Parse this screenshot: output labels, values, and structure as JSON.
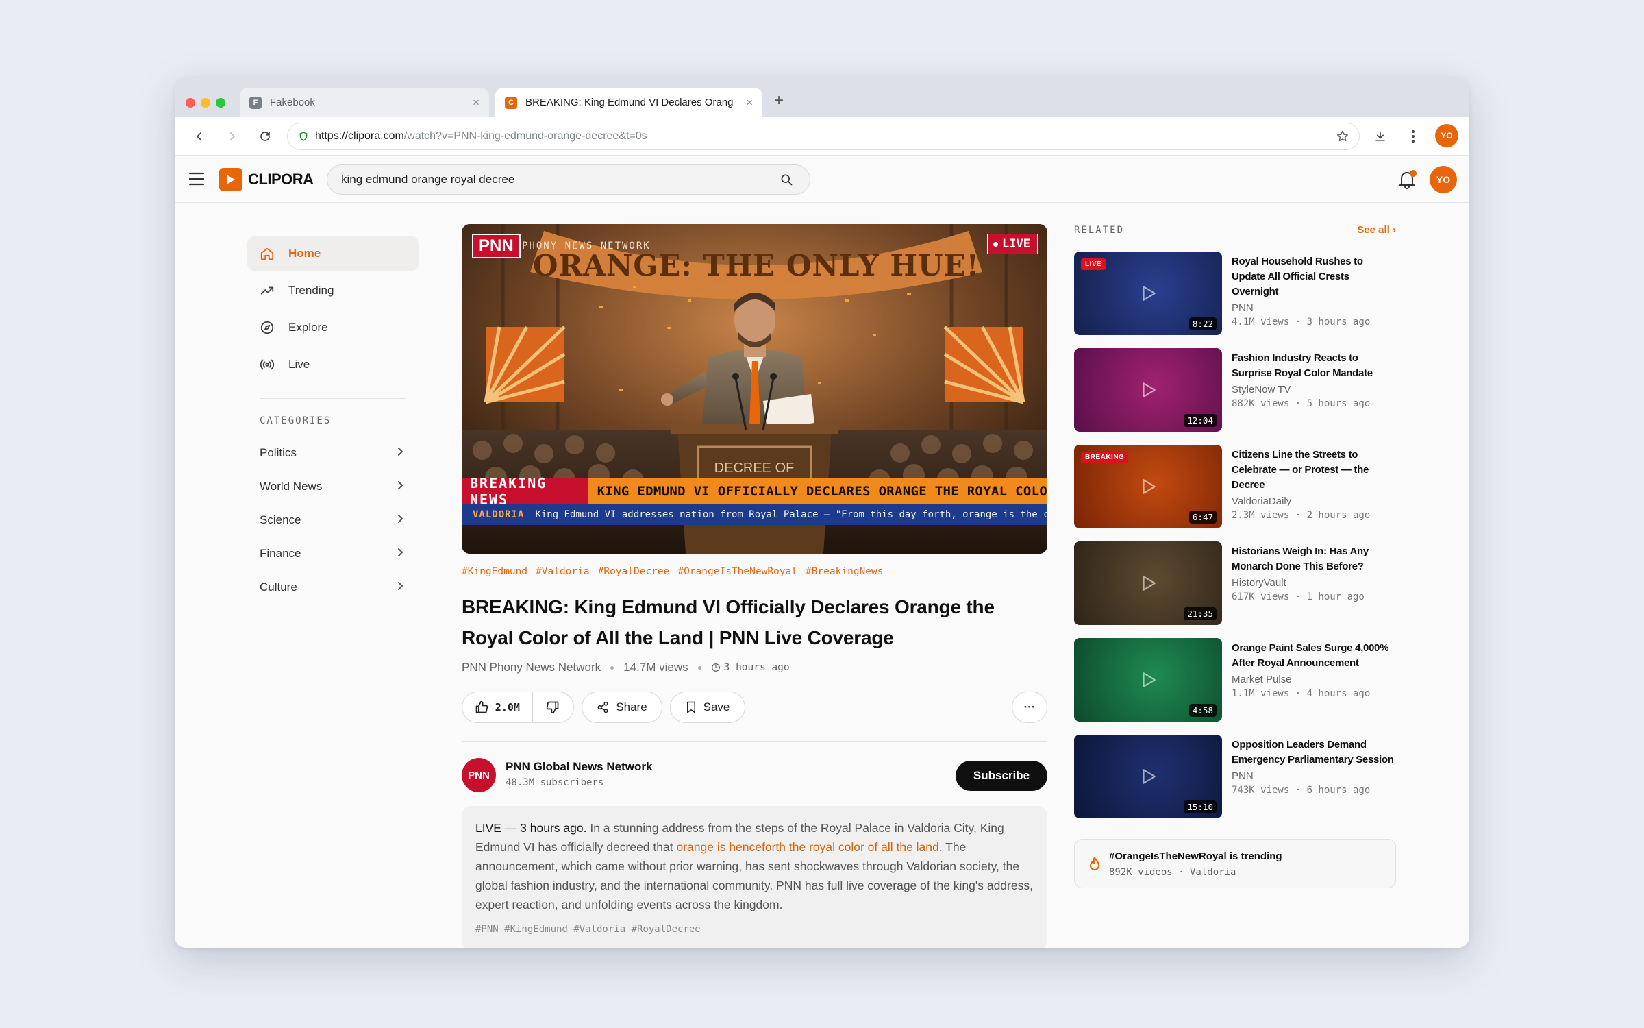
{
  "browser": {
    "tabs": [
      {
        "label": "Fakebook",
        "favicon": "F",
        "favicon_color": "#7a7f87"
      },
      {
        "label": "BREAKING: King Edmund VI Declares Orang",
        "favicon": "C",
        "favicon_color": "#e8650a"
      }
    ],
    "url_scheme_host": "https://clipora.com",
    "url_path": "/watch?v=PNN-king-edmund-orange-decree&t=0s",
    "profile_initials": "YO"
  },
  "site": {
    "logo_text": "CLIPORA",
    "search_value": "king edmund orange royal decree",
    "user_initials": "YO",
    "accent": "#e8650a"
  },
  "sidebar": {
    "nav": [
      {
        "label": "Home",
        "icon": "home-icon"
      },
      {
        "label": "Trending",
        "icon": "trending-icon"
      },
      {
        "label": "Explore",
        "icon": "compass-icon"
      },
      {
        "label": "Live",
        "icon": "broadcast-icon"
      }
    ],
    "categories_heading": "CATEGORIES",
    "categories": [
      "Politics",
      "World News",
      "Science",
      "Finance",
      "Culture"
    ]
  },
  "player": {
    "network_badge": "PNN",
    "network_name": "PHONY NEWS NETWORK",
    "live_label": "LIVE",
    "banner_text": "ORANGE: THE ONLY HUE!",
    "podium_text": "DECREE OF",
    "breaking_label": "BREAKING NEWS",
    "headline": "KING EDMUND VI OFFICIALLY DECLARES ORANGE THE ROYAL COLOR OF ALL",
    "ticker_place": "VALDORIA",
    "ticker_text": "King Edmund VI addresses nation from Royal Palace — \"From this day forth, orange is the color of our glory\""
  },
  "video": {
    "hashtags": [
      "#KingEdmund",
      "#Valdoria",
      "#RoyalDecree",
      "#OrangeIsTheNewRoyal",
      "#BreakingNews"
    ],
    "title": "BREAKING: King Edmund VI Officially Declares Orange the Royal Color of All the Land | PNN Live Coverage",
    "channel_short": "PNN Phony News Network",
    "views": "14.7M views",
    "age": "3 hours ago",
    "likes": "2.0M",
    "share_label": "Share",
    "save_label": "Save",
    "more_label": "···"
  },
  "channel": {
    "logo_text": "PNN",
    "name": "PNN Global News Network",
    "subscribers": "48.3M subscribers",
    "subscribe_label": "Subscribe"
  },
  "description": {
    "lead": "LIVE — 3 hours ago.",
    "part1": " In a stunning address from the steps of the Royal Palace in Valdoria City, King Edmund VI has officially decreed that ",
    "highlight": "orange is henceforth the royal color of all the land",
    "part2": ". The announcement, which came without prior warning, has sent shockwaves through Valdorian society, the global fashion industry, and the international community. PNN has full live coverage of the king's address, expert reaction, and unfolding events across the kingdom.",
    "tags": "#PNN #KingEdmund #Valdoria #RoyalDecree"
  },
  "related": {
    "heading": "RELATED",
    "see_all": "See all ›",
    "items": [
      {
        "title": "Royal Household Rushes to Update All Official Crests Overnight",
        "channel": "PNN",
        "meta": "4.1M views · 3 hours ago",
        "duration": "8:22",
        "badge": "LIVE",
        "color_a": "#2a3f8f",
        "color_b": "#15204d"
      },
      {
        "title": "Fashion Industry Reacts to Surprise Royal Color Mandate",
        "channel": "StyleNow TV",
        "meta": "882K views · 5 hours ago",
        "duration": "12:04",
        "badge": "",
        "color_a": "#a0226e",
        "color_b": "#5a0f4a"
      },
      {
        "title": "Citizens Line the Streets to Celebrate — or Protest — the Decree",
        "channel": "ValdoriaDaily",
        "meta": "2.3M views · 2 hours ago",
        "duration": "6:47",
        "badge": "BREAKING",
        "color_a": "#c24a10",
        "color_b": "#7a2406"
      },
      {
        "title": "Historians Weigh In: Has Any Monarch Done This Before?",
        "channel": "HistoryVault",
        "meta": "617K views · 1 hour ago",
        "duration": "21:35",
        "badge": "",
        "color_a": "#5e4a30",
        "color_b": "#2d2418"
      },
      {
        "title": "Orange Paint Sales Surge 4,000% After Royal Announcement",
        "channel": "Market Pulse",
        "meta": "1.1M views · 4 hours ago",
        "duration": "4:58",
        "badge": "",
        "color_a": "#1f8a52",
        "color_b": "#0d4a2b"
      },
      {
        "title": "Opposition Leaders Demand Emergency Parliamentary Session",
        "channel": "PNN",
        "meta": "743K views · 6 hours ago",
        "duration": "15:10",
        "badge": "",
        "color_a": "#1f3070",
        "color_b": "#0c1638"
      }
    ],
    "trending_title": "#OrangeIsTheNewRoyal is trending",
    "trending_meta": "892K videos · Valdoria"
  }
}
